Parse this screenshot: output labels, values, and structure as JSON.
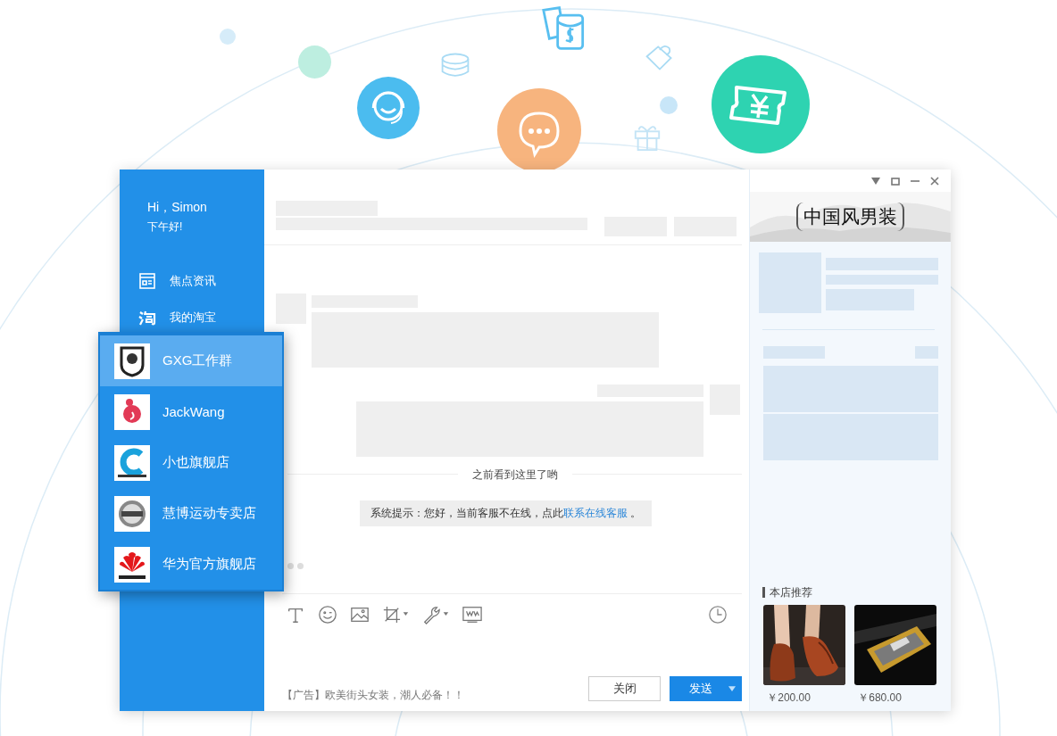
{
  "sidebar": {
    "greeting": "Hi，Simon",
    "subgreeting": "下午好!",
    "items": [
      {
        "kind": "news",
        "label": "焦点资讯"
      },
      {
        "kind": "taobao",
        "label": "我的淘宝"
      }
    ]
  },
  "contacts": [
    {
      "kind": "shield",
      "name": "GXG工作群",
      "selected": true
    },
    {
      "kind": "bird",
      "name": "JackWang",
      "selected": false
    },
    {
      "kind": "letter",
      "name": "小也旗舰店",
      "selected": false
    },
    {
      "kind": "badge",
      "name": "慧博运动专卖店",
      "selected": false
    },
    {
      "kind": "flower",
      "name": "华为官方旗舰店",
      "selected": false
    }
  ],
  "chat": {
    "divider": "之前看到这里了哟",
    "notice": {
      "text": "系统提示：您好，当前客服不在线，点此",
      "link": "联系在线客服",
      "end": "。"
    },
    "ad": "【广告】欧美街头女装，潮人必备！！",
    "buttons": [
      {
        "kind": "secondary",
        "label": "关闭"
      },
      {
        "kind": "primary",
        "label": "发送"
      }
    ]
  },
  "shop": {
    "banner": "中国风男装",
    "recommend_title": "本店推荐",
    "products": [
      {
        "kind": "shoe",
        "price": "￥200.00"
      },
      {
        "kind": "belt",
        "price": "￥680.00"
      }
    ]
  }
}
